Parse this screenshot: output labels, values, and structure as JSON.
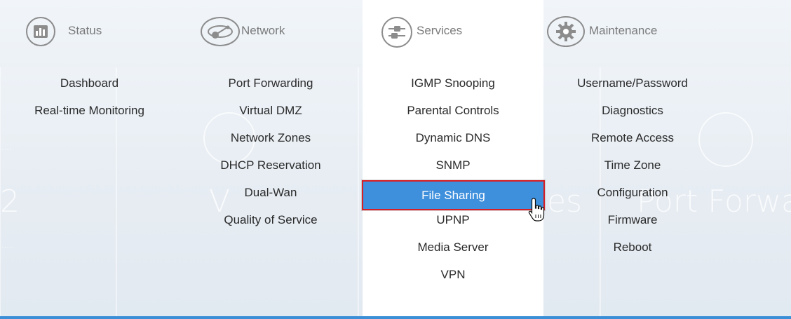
{
  "menu": {
    "columns": [
      {
        "header": "Status",
        "icon": "bar-chart-icon",
        "items": [
          "Dashboard",
          "Real-time Monitoring"
        ]
      },
      {
        "header": "Network",
        "icon": "network-link-icon",
        "items": [
          "Port Forwarding",
          "Virtual DMZ",
          "Network Zones",
          "DHCP Reservation",
          "Dual-Wan",
          "Quality of Service"
        ]
      },
      {
        "header": "Services",
        "icon": "sliders-icon",
        "items": [
          "IGMP Snooping",
          "Parental Controls",
          "Dynamic DNS",
          "SNMP",
          "File Sharing",
          "UPNP",
          "Media Server",
          "VPN"
        ],
        "active": true,
        "highlighted_item": "File Sharing"
      },
      {
        "header": "Maintenance",
        "icon": "gear-icon",
        "items": [
          "Username/Password",
          "Diagnostics",
          "Remote Access",
          "Time Zone",
          "Configuration",
          "Firmware",
          "Reboot"
        ]
      }
    ]
  },
  "colors": {
    "highlight_fill": "#3e8fdc",
    "highlight_border": "#d81f26",
    "accent_line": "#3b8fd7",
    "icon_gray": "#8c8c8c"
  },
  "cursor": "hand-pointer-icon"
}
